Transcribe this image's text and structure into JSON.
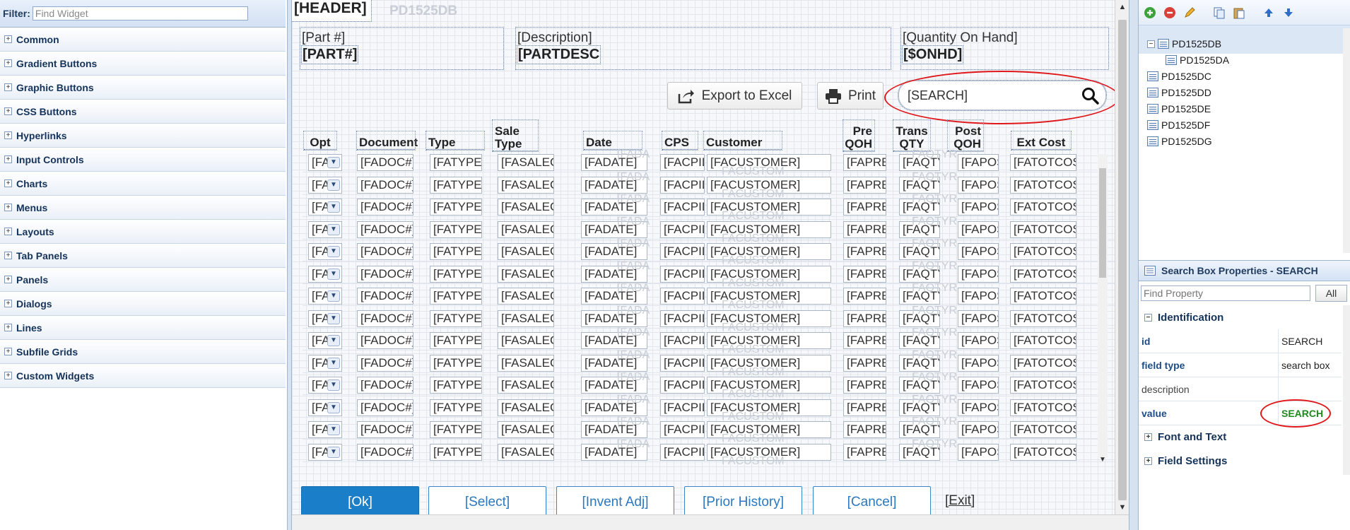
{
  "left_panel": {
    "filter_label": "Filter:",
    "filter_placeholder": "Find Widget",
    "categories": [
      "Common",
      "Gradient Buttons",
      "Graphic Buttons",
      "CSS Buttons",
      "Hyperlinks",
      "Input Controls",
      "Charts",
      "Menus",
      "Layouts",
      "Tab Panels",
      "Panels",
      "Dialogs",
      "Lines",
      "Subfile Grids",
      "Custom Widgets"
    ]
  },
  "design": {
    "header_field": "[HEADER]",
    "header_ghost": "PD1525DB",
    "part_label": "[Part #]",
    "part_value": "[PART#]",
    "desc_label": "[Description]",
    "desc_value": "[PARTDESC",
    "qoh_label": "[Quantity On Hand]",
    "qoh_value": "[$ONHD]",
    "export_button": "Export to Excel",
    "print_button": "Print",
    "search_value": "[SEARCH]",
    "grid_headers": [
      "Opt",
      "Document",
      "Type",
      "Sale Type",
      "Date",
      "CPS",
      "Customer",
      "Pre QOH",
      "Trans QTY",
      "Post QOH",
      "Ext Cost"
    ],
    "row_values": [
      "[FA",
      "[FADOC#]",
      "[FATYPE]",
      "[FASALEC",
      "[FADATE]",
      "[FACPID",
      "[FACUSTOMER]",
      "[FAPREC",
      "[FAQTY",
      "[FAPOS",
      "[FATOTCOS"
    ],
    "ghost_values": [
      "[FADA",
      "FACUSTOM",
      "FAQTYR"
    ],
    "row_count": 14,
    "buttons": {
      "ok": "[Ok]",
      "select": "[Select]",
      "invent_adj": "[Invent Adj]",
      "prior_history": "[Prior History]",
      "cancel": "[Cancel]",
      "exit": "[Exit]"
    }
  },
  "right_panel": {
    "tree": [
      "PD1525DB",
      "PD1525DA",
      "PD1525DC",
      "PD1525DD",
      "PD1525DE",
      "PD1525DF",
      "PD1525DG"
    ],
    "props_title": "Search Box Properties - SEARCH",
    "find_property_placeholder": "Find Property",
    "all_button": "All",
    "section_identification": "Identification",
    "props": [
      {
        "key": "id",
        "value": "SEARCH"
      },
      {
        "key": "field type",
        "value": "search box"
      },
      {
        "key": "description",
        "value": ""
      },
      {
        "key": "value",
        "value": "SEARCH"
      }
    ],
    "section_font": "Font and Text",
    "section_field": "Field Settings"
  },
  "colors": {
    "accent": "#1a7fc8",
    "annotation": "#e0181b",
    "value_green": "#1e8a1e"
  }
}
